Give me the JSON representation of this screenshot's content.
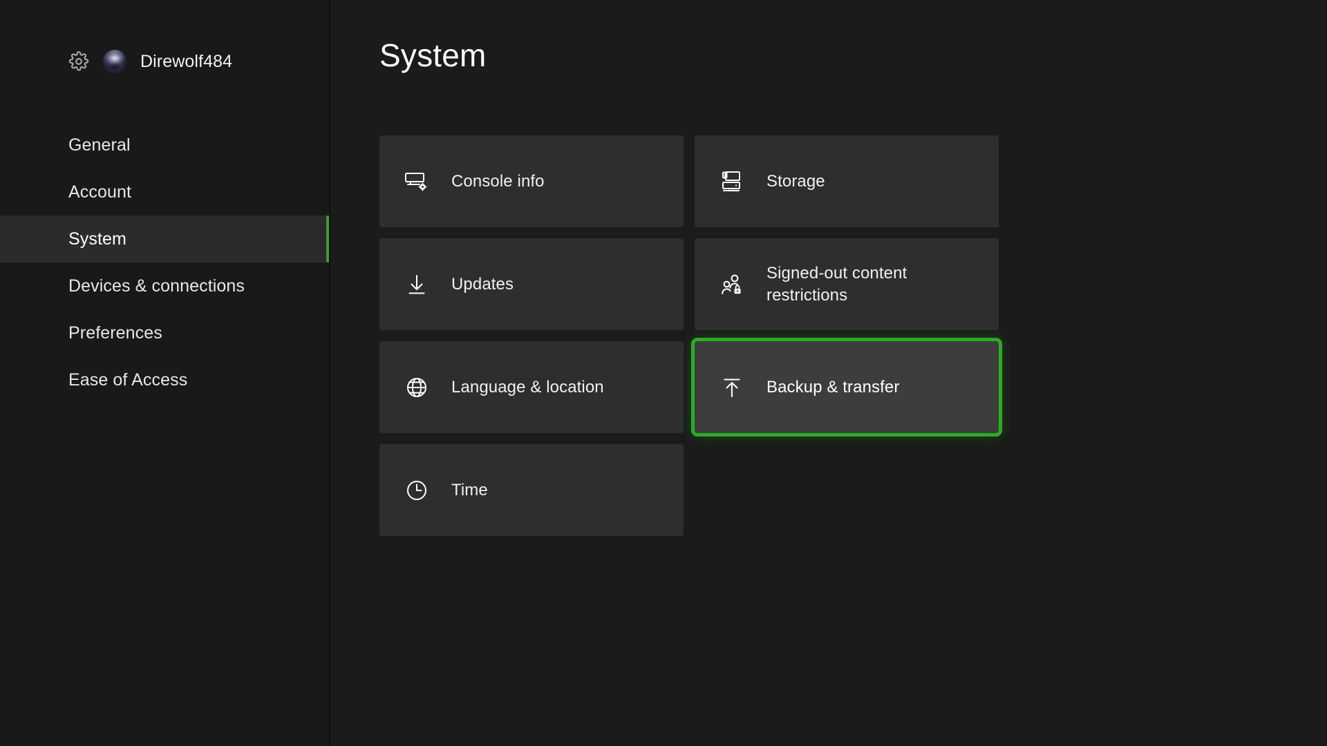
{
  "window": {
    "app": "Xbox Settings"
  },
  "sidebar": {
    "profile": {
      "gear_icon": "gear-icon",
      "avatar_icon": "avatar",
      "gamertag": "Direwolf484"
    },
    "items": [
      {
        "label": "General",
        "active": false
      },
      {
        "label": "Account",
        "active": false
      },
      {
        "label": "System",
        "active": true
      },
      {
        "label": "Devices & connections",
        "active": false
      },
      {
        "label": "Preferences",
        "active": false
      },
      {
        "label": "Ease of Access",
        "active": false
      }
    ]
  },
  "main": {
    "title": "System",
    "tiles": [
      {
        "label": "Console info",
        "icon": "console-settings-icon",
        "focused": false
      },
      {
        "label": "Storage",
        "icon": "storage-drive-icon",
        "focused": false
      },
      {
        "label": "Updates",
        "icon": "download-arrow-icon",
        "focused": false
      },
      {
        "label": "Signed-out content restrictions",
        "icon": "people-lock-icon",
        "focused": false
      },
      {
        "label": "Language & location",
        "icon": "globe-icon",
        "focused": false
      },
      {
        "label": "Backup & transfer",
        "icon": "upload-arrow-icon",
        "focused": true
      },
      {
        "label": "Time",
        "icon": "clock-icon",
        "focused": false
      }
    ]
  },
  "colors": {
    "accent_green": "#3a9e2f",
    "focus_green": "#2bad22",
    "page_background": "#1b1b1b",
    "sidebar_background": "#191919",
    "tile_background": "#2e2e2e",
    "tile_focused_background": "#3d3d3d",
    "active_nav_background": "#2b2b2b",
    "text_primary": "#ffffff"
  }
}
